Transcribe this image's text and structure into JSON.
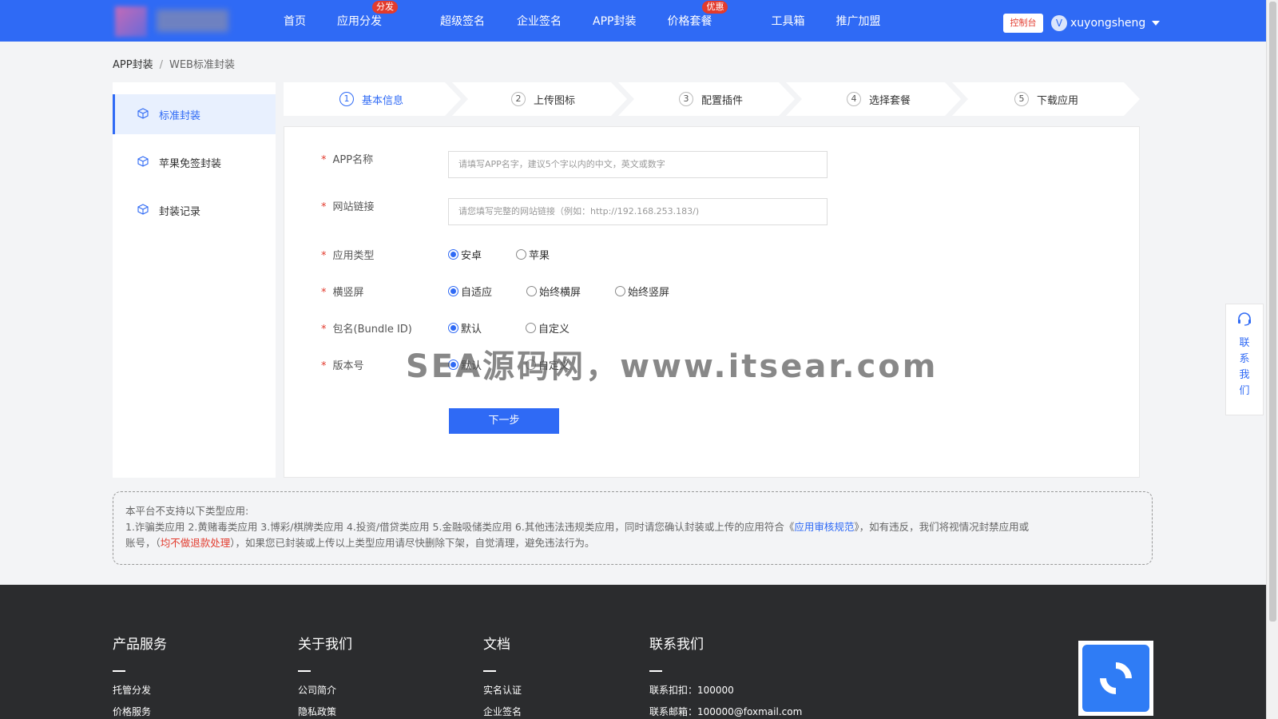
{
  "nav": {
    "items": [
      {
        "label": "首页"
      },
      {
        "label": "应用分发",
        "badge": "分发"
      },
      {
        "label": "超级签名"
      },
      {
        "label": "企业签名"
      },
      {
        "label": "APP封装"
      },
      {
        "label": "价格套餐",
        "badge": "优惠"
      },
      {
        "label": "工具箱"
      },
      {
        "label": "推广加盟"
      }
    ],
    "console_label": "控制台",
    "avatar_letter": "V",
    "username": "xuyongsheng"
  },
  "breadcrumb": {
    "parent": "APP封装",
    "sep": "/",
    "current": "WEB标准封装"
  },
  "sidebar": {
    "items": [
      {
        "label": "标准封装",
        "icon": "cube-icon"
      },
      {
        "label": "苹果免签封装",
        "icon": "cube-icon"
      },
      {
        "label": "封装记录",
        "icon": "cube-icon"
      }
    ]
  },
  "steps": [
    {
      "num": "1",
      "label": "基本信息"
    },
    {
      "num": "2",
      "label": "上传图标"
    },
    {
      "num": "3",
      "label": "配置插件"
    },
    {
      "num": "4",
      "label": "选择套餐"
    },
    {
      "num": "5",
      "label": "下载应用"
    }
  ],
  "form": {
    "required_mark": "*",
    "app_name": {
      "label": "APP名称",
      "placeholder": "请填写APP名字，建议5个字以内的中文，英文或数字"
    },
    "site_url": {
      "label": "网站链接",
      "placeholder": "请您填写完整的网站链接（例如：http://192.168.253.183/)"
    },
    "app_type": {
      "label": "应用类型",
      "options": [
        "安卓",
        "苹果"
      ],
      "selected": "安卓"
    },
    "orientation": {
      "label": "横竖屏",
      "options": [
        "自适应",
        "始终横屏",
        "始终竖屏"
      ],
      "selected": "自适应"
    },
    "bundle_id": {
      "label": "包名(Bundle ID)",
      "options": [
        "默认",
        "自定义"
      ],
      "selected": "默认"
    },
    "version": {
      "label": "版本号",
      "options": [
        "默认",
        "自定义"
      ],
      "selected": "默认"
    },
    "next_label": "下一步"
  },
  "watermark": "SEA源码网，www.itsear.com",
  "contact_float": {
    "label": "联系我们",
    "icon": "headset-icon"
  },
  "notice": {
    "line1": "本平台不支持以下类型应用:",
    "line2_a": "1.诈骗类应用 2.黄赌毒类应用 3.博彩/棋牌类应用 4.投资/借贷类应用 5.金融吸储类应用 6.其他违法违规类应用，同时请您确认封装或上传的应用符合《",
    "line2_link": "应用审核规范",
    "line2_b": "》，如有违反，我们将视情况封禁应用或",
    "line3_a": "账号，（",
    "line3_red": "均不做退款处理",
    "line3_b": "），如果您已封装或上传以上类型应用请尽快删除下架，自觉清理，避免违法行为。"
  },
  "footer": {
    "cols": [
      {
        "title": "产品服务",
        "links": [
          "托管分发",
          "价格服务"
        ]
      },
      {
        "title": "关于我们",
        "links": [
          "公司简介",
          "隐私政策"
        ]
      },
      {
        "title": "文档",
        "links": [
          "实名认证",
          "企业签名"
        ]
      },
      {
        "title": "联系我们",
        "links": [
          "联系扣扣：100000",
          "联系邮箱：100000@foxmail.com"
        ]
      }
    ]
  },
  "colors": {
    "primary": "#2f6af5",
    "badge": "#e23b2e",
    "footer_bg": "#2b2c2e"
  }
}
